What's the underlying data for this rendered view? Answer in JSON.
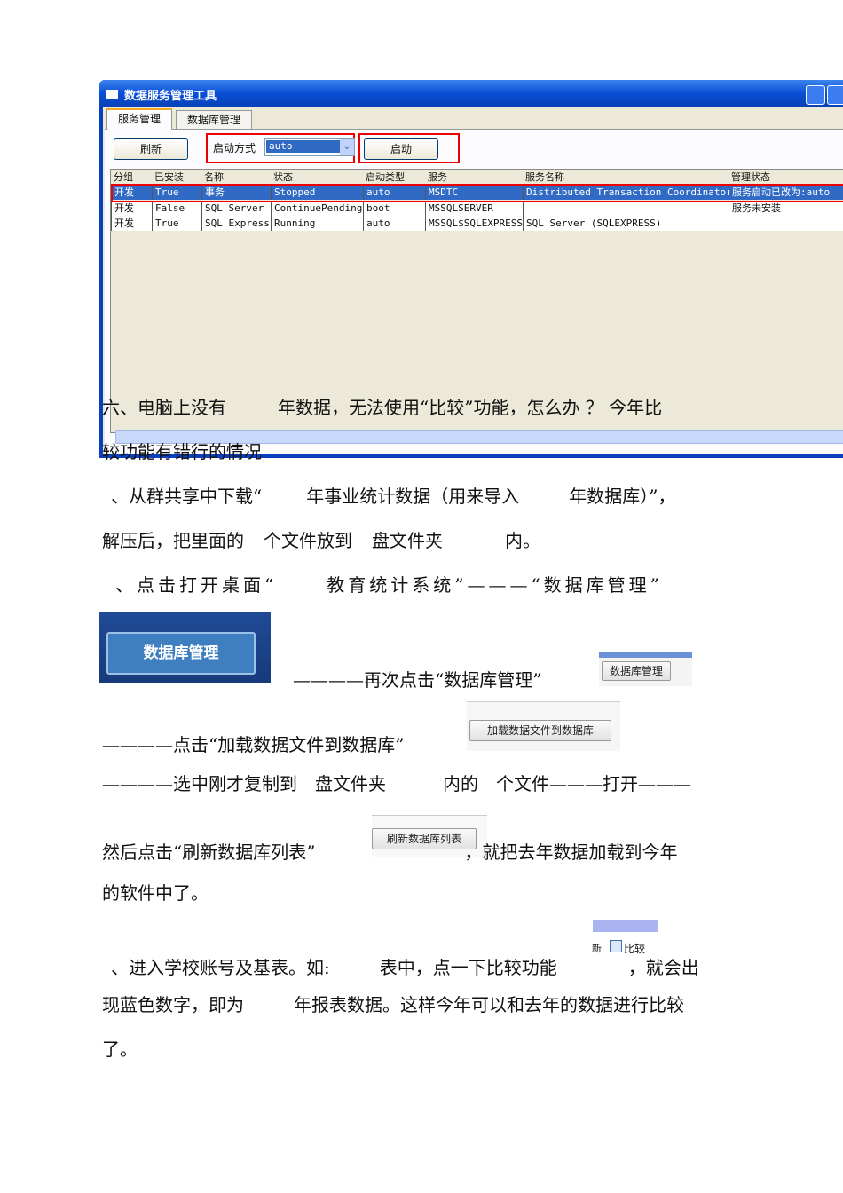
{
  "window": {
    "title": "数据服务管理工具",
    "tabs": [
      "服务管理",
      "数据库管理"
    ],
    "refresh_button": "刷新",
    "start_mode_label": "启动方式",
    "start_mode_value": "auto",
    "start_button": "启动",
    "columns": [
      "分组",
      "已安装",
      "名称",
      "状态",
      "启动类型",
      "服务",
      "服务名称",
      "管理状态"
    ],
    "rows": [
      [
        "开发",
        "True",
        "事务",
        "Stopped",
        "auto",
        "MSDTC",
        "Distributed Transaction Coordinator",
        "服务启动已改为:auto"
      ],
      [
        "开发",
        "False",
        "SQL Server",
        "ContinuePending",
        "boot",
        "MSSQLSERVER",
        "",
        "服务未安装"
      ],
      [
        "开发",
        "True",
        "SQL Express",
        "Running",
        "auto",
        "MSSQL$SQLEXPRESS",
        "SQL Server (SQLEXPRESS)",
        ""
      ]
    ]
  },
  "doc": {
    "l1": [
      "六、电脑上没有",
      "年数据，无法使用“比较”功能，怎么办 ？ 今年比"
    ],
    "l2": "较功能有错行的情况",
    "l3": [
      "、从群共享中下载“",
      "年事业统计数据（用来导入",
      "年数据库）”，"
    ],
    "l4": [
      "解压后，把里面的",
      "个文件放到",
      "盘文件夹",
      "内。"
    ],
    "l5": [
      "、点击打开桌面“",
      "教育统计系统”———“数据库管理”"
    ],
    "db_button": "数据库管理",
    "l6": "————再次点击“数据库管理”",
    "db_tab": "数据库管理",
    "l7": "————点击“加载数据文件到数据库”",
    "load_button": "加载数据文件到数据库",
    "l8": [
      "————选中刚才复制到",
      "盘文件夹",
      "内的",
      "个文件———打开———"
    ],
    "l9": [
      "然后点击“刷新数据库列表”",
      "，就把去年数据加载到今年"
    ],
    "refresh_list_button": "刷新数据库列表",
    "l10": "的软件中了。",
    "compare_prefix": "新",
    "compare_button": "比较",
    "l11": [
      "、进入学校账号及基表。如:",
      "表中，点一下比较功能",
      "，就会出"
    ],
    "l12": [
      "现蓝色数字，即为",
      "年报表数据。这样今年可以和去年的数据进行比较"
    ],
    "l13": "了。"
  }
}
